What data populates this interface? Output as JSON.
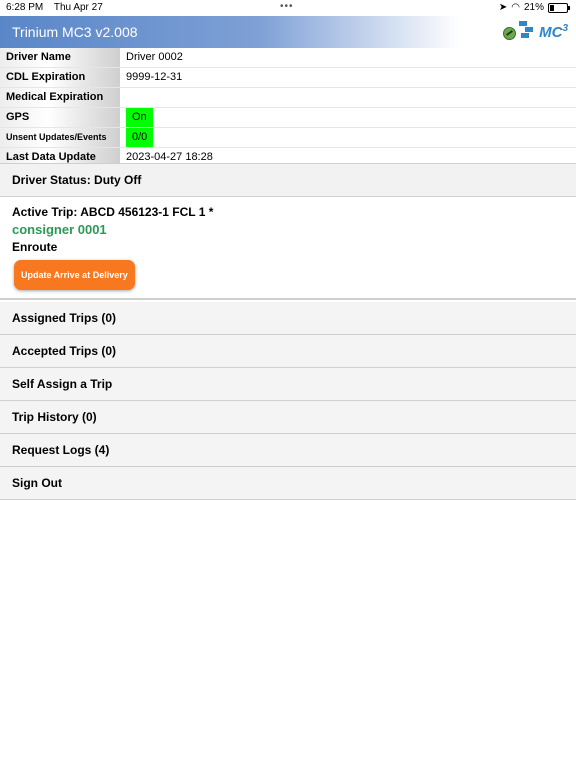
{
  "status_bar": {
    "time": "6:28 PM",
    "date": "Thu Apr 27",
    "dots": "•••",
    "battery": "21%"
  },
  "header": {
    "title": "Trinium MC3 v2.008",
    "logo_text": "MC",
    "logo_sup": "3"
  },
  "info": [
    {
      "label": "Driver Name",
      "value": "Driver 0002"
    },
    {
      "label": "CDL Expiration",
      "value": "9999-12-31"
    },
    {
      "label": "Medical Expiration",
      "value": ""
    },
    {
      "label": "GPS",
      "value": "On"
    },
    {
      "label": "Unsent Updates/Events",
      "value": "0/0"
    },
    {
      "label": "Last Data Update",
      "value": "2023-04-27 18:28"
    }
  ],
  "driver_status": "Driver Status: Duty Off",
  "active_trip": {
    "title": "Active Trip: ABCD 456123-1 FCL 1 *",
    "consigner": "consigner 0001",
    "status": "Enroute",
    "button": "Update Arrive at Delivery"
  },
  "menu": [
    "Assigned Trips (0)",
    "Accepted Trips (0)",
    "Self Assign a Trip",
    "Trip History (0)",
    "Request Logs (4)",
    "Sign Out"
  ],
  "colors": {
    "header_blue": "#5a86c8",
    "badge_green": "#00ff00",
    "consigner_green": "#2b9a57",
    "button_orange": "#f7781f"
  }
}
